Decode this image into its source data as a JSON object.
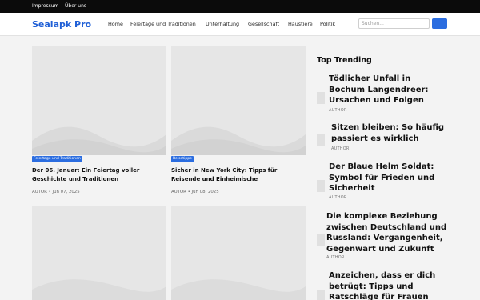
{
  "topbar": {
    "links": [
      "Impressum",
      "Über uns"
    ]
  },
  "header": {
    "logo": "Sealapk Pro",
    "nav": [
      "Home",
      "Feiertage und Traditionen",
      "Unterhaltung",
      "Gesellschaft",
      "Haustiere",
      "Politik"
    ],
    "search_placeholder": "Suchen..."
  },
  "posts": [
    {
      "category": "Feiertage und Traditionen",
      "title_lines": [
        "Der 06. Januar: Ein Feiertag voller",
        "Geschichte und Traditionen"
      ],
      "meta": "AUTOR • Jun 07, 2025"
    },
    {
      "category": "Reisetipps",
      "title_lines": [
        "Sicher in New York City: Tipps für",
        "Reisende und Einheimische"
      ],
      "meta": "AUTOR • Jun 08, 2025"
    }
  ],
  "sidebar": {
    "title": "Top Trending",
    "items": [
      {
        "title_lines": [
          "Tödlicher Unfall in",
          "Bochum Langendreer:",
          "Ursachen und Folgen"
        ],
        "author": "AUTHOR"
      },
      {
        "title_lines": [
          "Sitzen bleiben: So häufig",
          "passiert es wirklich"
        ],
        "author": "AUTHOR"
      },
      {
        "title_lines": [
          "Der Blaue Helm Soldat:",
          "Symbol für Frieden und",
          "Sicherheit"
        ],
        "author": "AUTHOR"
      },
      {
        "title_lines": [
          "Die komplexe Beziehung",
          "zwischen Deutschland und",
          "Russland: Vergangenheit,",
          "Gegenwart und Zukunft"
        ],
        "author": "AUTHOR"
      },
      {
        "title_lines": [
          "Anzeichen, dass er dich",
          "betrügt: Tipps und",
          "Ratschläge für Frauen"
        ],
        "author": ""
      }
    ]
  },
  "colors": {
    "accent": "#2b6de0",
    "logo": "#1f5fd6",
    "topbar": "#0b0b0b",
    "placeholder_image": "#e6e6e6"
  }
}
